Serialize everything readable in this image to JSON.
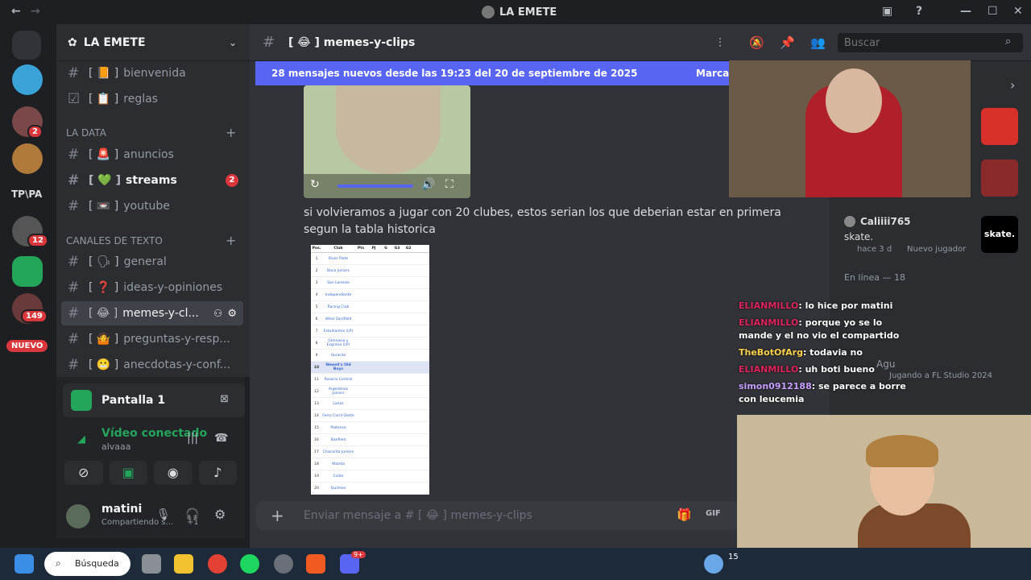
{
  "window": {
    "title": "LA EMETE"
  },
  "rail": {
    "badges": [
      "2",
      "12",
      "149"
    ],
    "labels": {
      "tpa": "TP\\PA",
      "nuevo": "NUEVO"
    }
  },
  "guild": {
    "name": "LA EMETE"
  },
  "channels_top": [
    {
      "emoji": "[ 📙 ]",
      "name": "bienvenida"
    },
    {
      "emoji": "[ 📋 ]",
      "name": "reglas"
    }
  ],
  "categories": {
    "la_data": "LA DATA",
    "canales": "CANALES DE TEXTO"
  },
  "channels_data": [
    {
      "emoji": "[ 🚨 ]",
      "name": "anuncios"
    },
    {
      "emoji": "[ 💚 ]",
      "name": "streams",
      "badge": "2"
    },
    {
      "emoji": "[ 📼 ]",
      "name": "youtube"
    }
  ],
  "channels_text": [
    {
      "emoji": "[ 🗣 ]",
      "name": "general"
    },
    {
      "emoji": "[ ❓ ]",
      "name": "ideas-y-opiniones"
    },
    {
      "emoji": "[ 😂 ]",
      "name": "memes-y-cl..."
    },
    {
      "emoji": "[ 🤷 ]",
      "name": "preguntas-y-resp..."
    },
    {
      "emoji": "[ 😬 ]",
      "name": "anecdotas-y-conf..."
    }
  ],
  "voice": {
    "screen": "Pantalla 1",
    "status": "Vídeo conectado",
    "user": "alvaaa"
  },
  "user": {
    "name": "matini",
    "status": "Compartiendo s...",
    "extra": "+1"
  },
  "chat": {
    "channel": "[ 😂 ] memes-y-clips",
    "search_placeholder": "Buscar",
    "new_messages": "28 mensajes nuevos desde las 19:23 del 20 de septiembre de 2025",
    "mark": "Marcar",
    "message": "si volvieramos a jugar con 20 clubes, estos serian los que deberian estar en primera segun la tabla historica",
    "input_placeholder": "Enviar mensaje a # [ 😂 ] memes-y-clips"
  },
  "table": {
    "headers": [
      "Pos.",
      "Club",
      "Pts",
      "PJ",
      "G",
      "G3",
      "G2"
    ],
    "clubs": [
      "River Plate",
      "Boca Juniors",
      "San Lorenzo",
      "Independiente",
      "Racing Club",
      "Vélez Sarsfield",
      "Estudiantes (LP)",
      "Gimnasia y Esgrima (LP)",
      "Huracán",
      "Newell's Old Boys",
      "Rosario Central",
      "Argentinos Juniors",
      "Lanús",
      "Ferro Carril Oeste",
      "Platense",
      "Banfield",
      "Chacarita Juniors",
      "Atlanta",
      "Colón",
      "Quilmes"
    ]
  },
  "members": {
    "user1": "Caliiii765",
    "user1_status": "skate.",
    "user1_meta": "hace 3 d",
    "user1_tag": "Nuevo jugador",
    "online": "En línea — 18",
    "user2": "Agu",
    "user2_status": "Jugando a FL Studio 2024",
    "skate": "skate."
  },
  "twitch": [
    {
      "user": "ELIANMILLO",
      "color": "#e0245e",
      "msg": ": lo hice por matini"
    },
    {
      "user": "ELIANMILLO",
      "color": "#e0245e",
      "msg": ": porque yo se lo mande y el no vio el compartido"
    },
    {
      "user": "TheBotOfArg",
      "color": "#ffd24d",
      "msg": ": todavia no"
    },
    {
      "user": "ELIANMILLO",
      "color": "#e0245e",
      "msg": ": uh boti bueno"
    },
    {
      "user": "simon0912188",
      "color": "#c9a0ff",
      "msg": ": se parece a borre con leucemia"
    }
  ],
  "taskbar": {
    "search": "Búsqueda",
    "time": "15",
    "discord_badge": "9+"
  }
}
